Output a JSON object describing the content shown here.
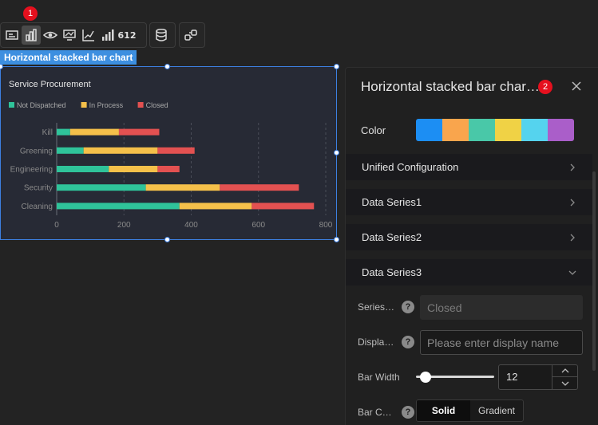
{
  "annotations": {
    "badge1": "1",
    "badge2": "2"
  },
  "toolbar": {
    "tools": [
      "image-card-icon",
      "bar-chart-icon",
      "eye-icon",
      "line-chart-icon",
      "scatter-icon",
      "signal-bars-icon",
      "number-icon"
    ],
    "number_text": "612",
    "extra": [
      "database-icon",
      "link-icon"
    ]
  },
  "chart_widget": {
    "label": "Horizontal stacked bar chart"
  },
  "chart_data": {
    "type": "bar",
    "orientation": "horizontal",
    "stacked": true,
    "title": "Service Procurement",
    "categories": [
      "Kill",
      "Greening",
      "Engineering",
      "Security",
      "Cleaning"
    ],
    "series": [
      {
        "name": "Not Dispatched",
        "color": "#2fc39a",
        "values": [
          40,
          80,
          155,
          265,
          365
        ]
      },
      {
        "name": "In Process",
        "color": "#f5c04a",
        "values": [
          145,
          220,
          145,
          220,
          215
        ]
      },
      {
        "name": "Closed",
        "color": "#e35151",
        "values": [
          120,
          110,
          65,
          235,
          185
        ]
      }
    ],
    "xticks": [
      "0",
      "200",
      "400",
      "600",
      "800"
    ],
    "xlim": [
      0,
      800
    ],
    "legend_position": "top-left",
    "grid": true
  },
  "panel": {
    "title": "Horizontal stacked bar char…",
    "color_label": "Color",
    "colors": [
      "#1c8ef3",
      "#f9a54d",
      "#49c8a8",
      "#f0d245",
      "#55d3ee",
      "#aa5ec9"
    ],
    "sections": [
      "Unified Configuration",
      "Data Series1",
      "Data Series2",
      "Data Series3"
    ],
    "series_name_label": "Series…",
    "series_name_value": "Closed",
    "display_label": "Displa…",
    "display_placeholder": "Please enter display name",
    "bar_width_label": "Bar Width",
    "bar_width_value": "12",
    "bar_color_label": "Bar C…",
    "bar_color_options": [
      "Solid",
      "Gradient"
    ],
    "bar_color_selected": "Solid",
    "help_glyph": "?"
  }
}
